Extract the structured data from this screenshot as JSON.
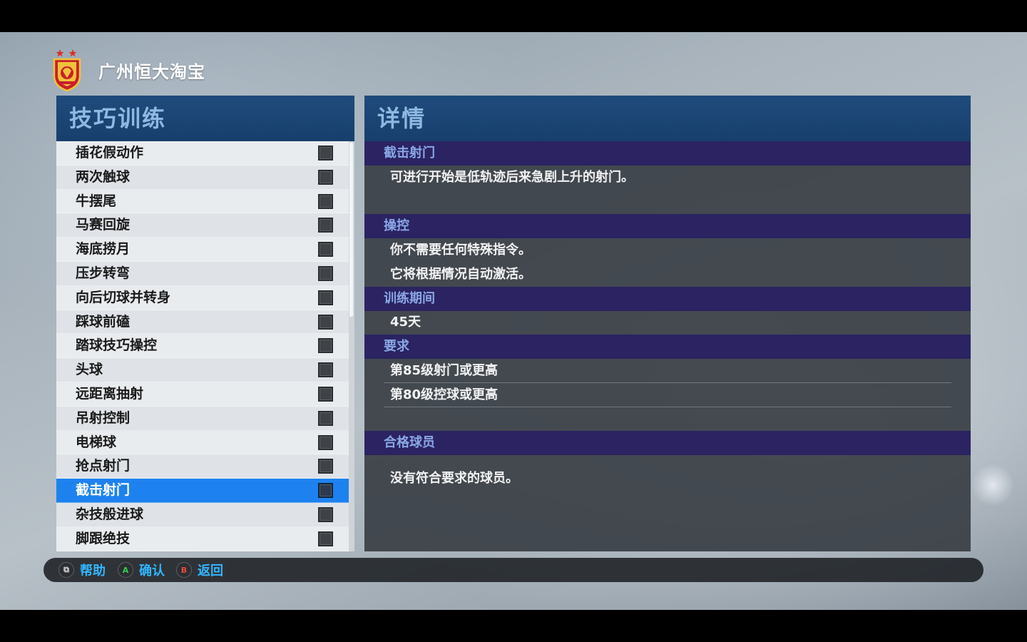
{
  "header": {
    "club_name": "广州恒大淘宝"
  },
  "left_panel": {
    "title": "技巧训练",
    "items": [
      {
        "label": "插花假动作"
      },
      {
        "label": "两次触球"
      },
      {
        "label": "牛摆尾"
      },
      {
        "label": "马赛回旋"
      },
      {
        "label": "海底捞月"
      },
      {
        "label": "压步转弯"
      },
      {
        "label": "向后切球并转身"
      },
      {
        "label": "踩球前磕"
      },
      {
        "label": "踏球技巧操控"
      },
      {
        "label": "头球"
      },
      {
        "label": "远距离抽射"
      },
      {
        "label": "吊射控制"
      },
      {
        "label": "电梯球"
      },
      {
        "label": "抢点射门"
      },
      {
        "label": "截击射门"
      },
      {
        "label": "杂技般进球"
      },
      {
        "label": "脚跟绝技"
      }
    ],
    "selected_item": "截击射门"
  },
  "right_panel": {
    "title": "详情",
    "skill_heading": "截击射门",
    "skill_description": "可进行开始是低轨迹后来急剧上升的射门。",
    "control_heading": "操控",
    "control_line1": "你不需要任何特殊指令。",
    "control_line2": "它将根据情况自动激活。",
    "period_heading": "训练期间",
    "period_value": "45天",
    "requirements_heading": "要求",
    "requirement1": "第85级射门或更高",
    "requirement2": "第80级控球或更高",
    "eligible_heading": "合格球员",
    "eligible_text": "没有符合要求的球员。"
  },
  "footer": {
    "help_label": "帮助",
    "confirm_label": "确认",
    "back_label": "返回",
    "a_glyph": "A",
    "b_glyph": "B",
    "help_glyph": "⧉"
  },
  "colors": {
    "selected_row": "#1d82ef",
    "section_bar": "#2b2362",
    "header_bar": "#1f4b7c",
    "footer_label": "#33b6ff"
  }
}
